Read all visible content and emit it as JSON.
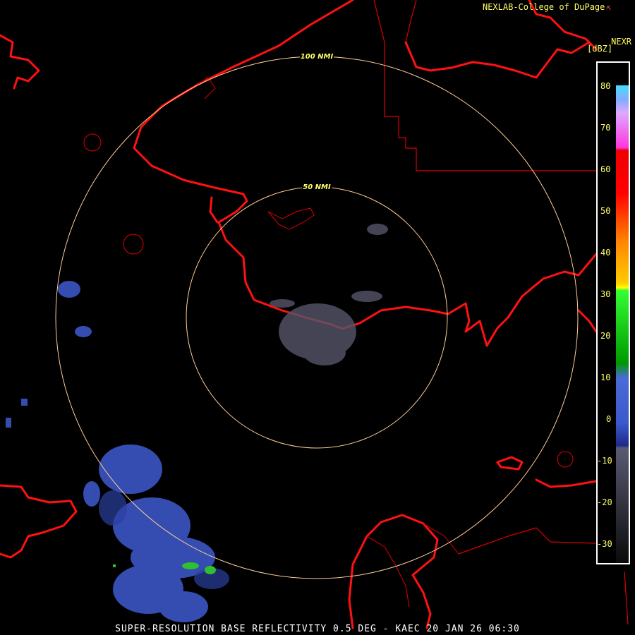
{
  "header": {
    "credit": "NEXLAB-College of DuPage",
    "credit_icon": "external-link-icon",
    "product": "NEXR",
    "unit": "[dBZ]"
  },
  "range_rings": [
    {
      "label": "100 NMI"
    },
    {
      "label": "50 NMI"
    }
  ],
  "colorbar": {
    "ticks": [
      "80",
      "70",
      "60",
      "50",
      "40",
      "30",
      "20",
      "10",
      "0",
      "-10",
      "-20",
      "-30"
    ],
    "colors": {
      "gray": "#55556a",
      "dark_blue": "#1e2a88",
      "blue": "#4a6ad6",
      "dark_green": "#0a8a0a",
      "green": "#44dd22",
      "yellow": "#ffee00",
      "orange": "#ff8800",
      "red": "#ff0000",
      "magenta": "#ff22dd",
      "pink": "#ffaaff",
      "cyan": "#44ddff"
    }
  },
  "map_colors": {
    "coastline": "#ff0000",
    "ring": "#ffcc99",
    "background": "#000000"
  },
  "footer": {
    "caption": "SUPER-RESOLUTION BASE REFLECTIVITY 0.5 DEG - KAEC 20 JAN 26 06:30"
  }
}
